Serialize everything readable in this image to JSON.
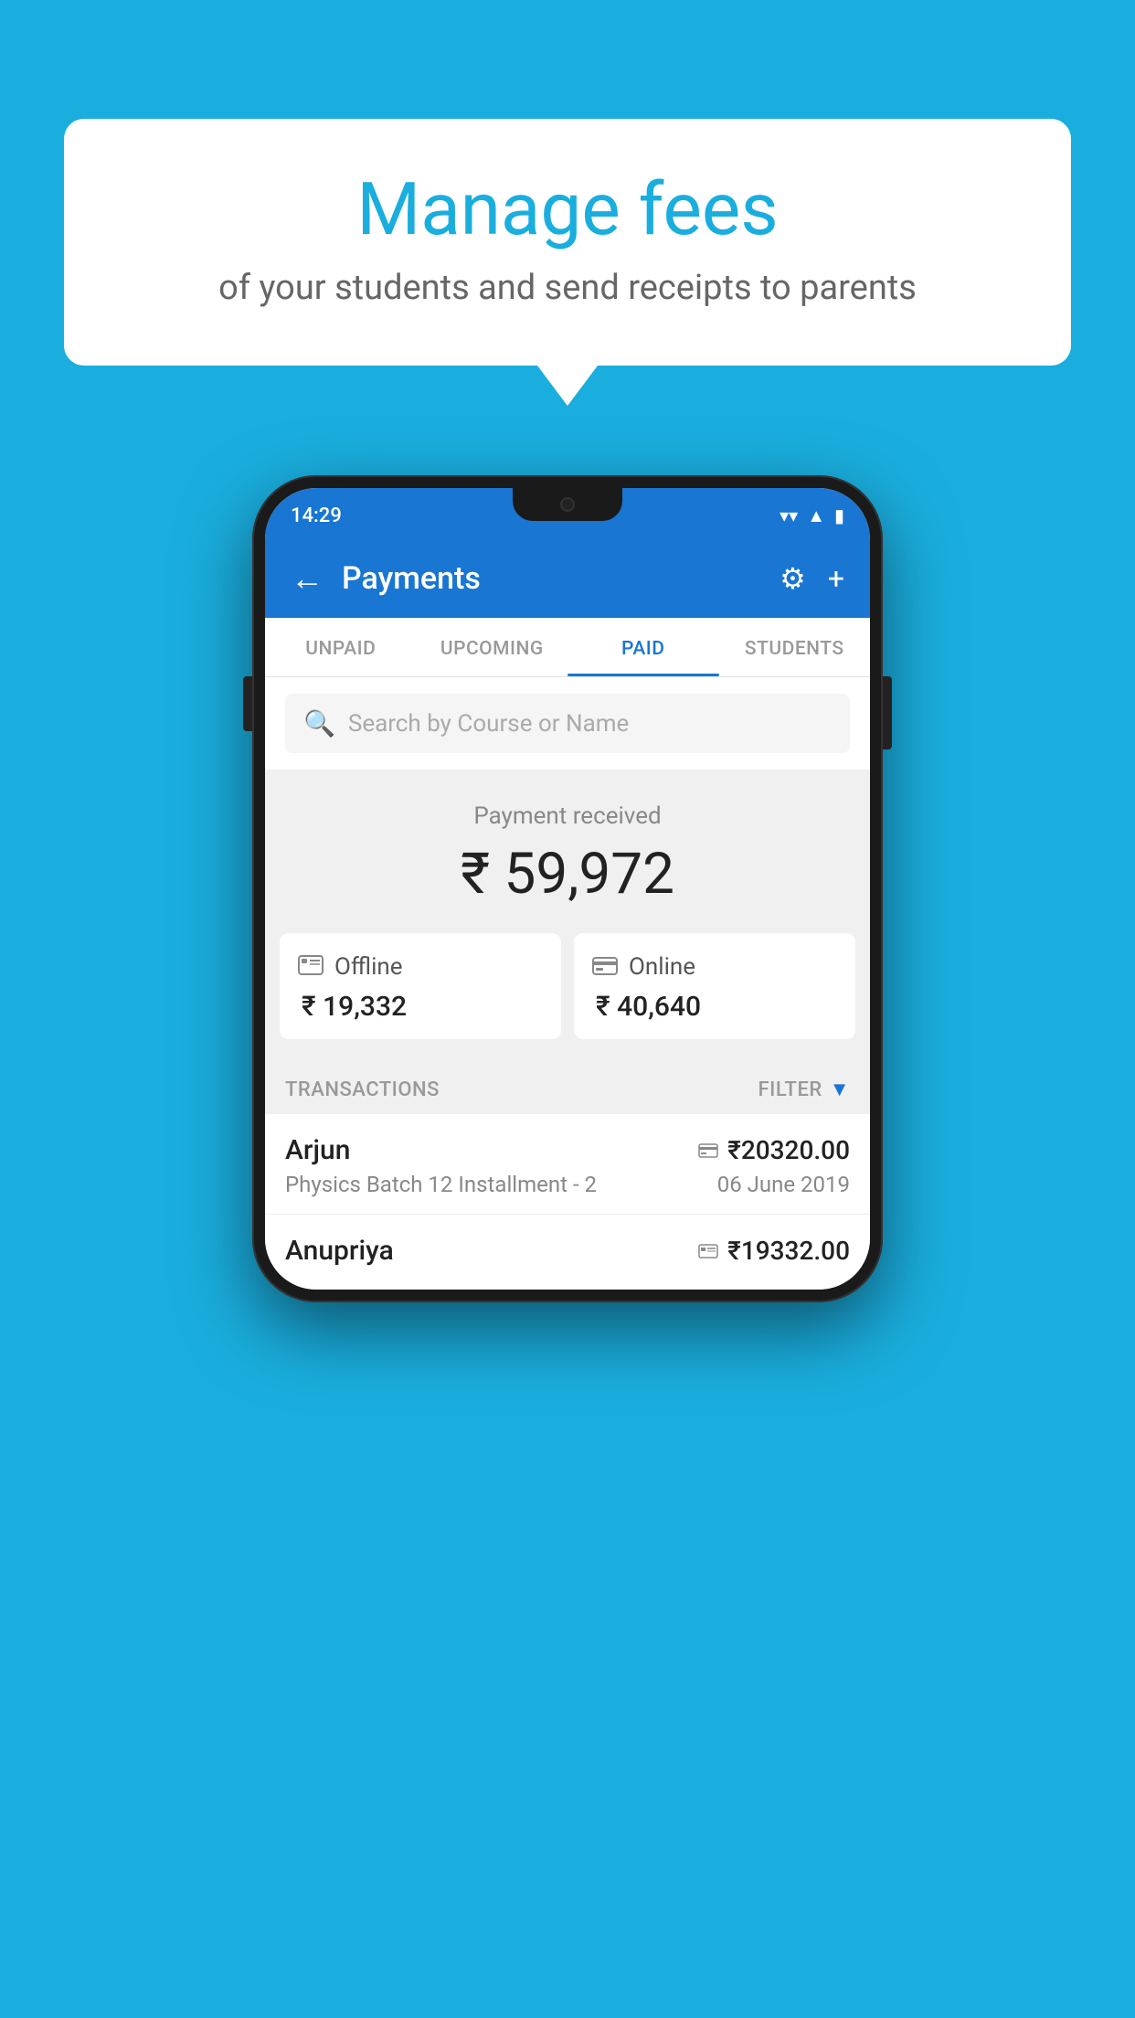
{
  "background_color": "#1aaede",
  "speech_bubble": {
    "title": "Manage fees",
    "subtitle": "of your students and send receipts to parents"
  },
  "phone": {
    "status_bar": {
      "time": "14:29",
      "icons": [
        "wifi",
        "signal",
        "battery"
      ]
    },
    "header": {
      "back_label": "←",
      "title": "Payments",
      "settings_label": "⚙",
      "add_label": "+"
    },
    "tabs": [
      {
        "id": "unpaid",
        "label": "UNPAID",
        "active": false
      },
      {
        "id": "upcoming",
        "label": "UPCOMING",
        "active": false
      },
      {
        "id": "paid",
        "label": "PAID",
        "active": true
      },
      {
        "id": "students",
        "label": "STUDENTS",
        "active": false
      }
    ],
    "search": {
      "placeholder": "Search by Course or Name"
    },
    "payment_summary": {
      "label": "Payment received",
      "amount": "₹ 59,972",
      "offline": {
        "type": "Offline",
        "amount": "₹ 19,332"
      },
      "online": {
        "type": "Online",
        "amount": "₹ 40,640"
      }
    },
    "transactions": {
      "section_label": "TRANSACTIONS",
      "filter_label": "FILTER",
      "items": [
        {
          "name": "Arjun",
          "course": "Physics Batch 12 Installment - 2",
          "amount": "₹20320.00",
          "date": "06 June 2019",
          "payment_type": "online"
        },
        {
          "name": "Anupriya",
          "course": "",
          "amount": "₹19332.00",
          "date": "",
          "payment_type": "offline"
        }
      ]
    }
  }
}
